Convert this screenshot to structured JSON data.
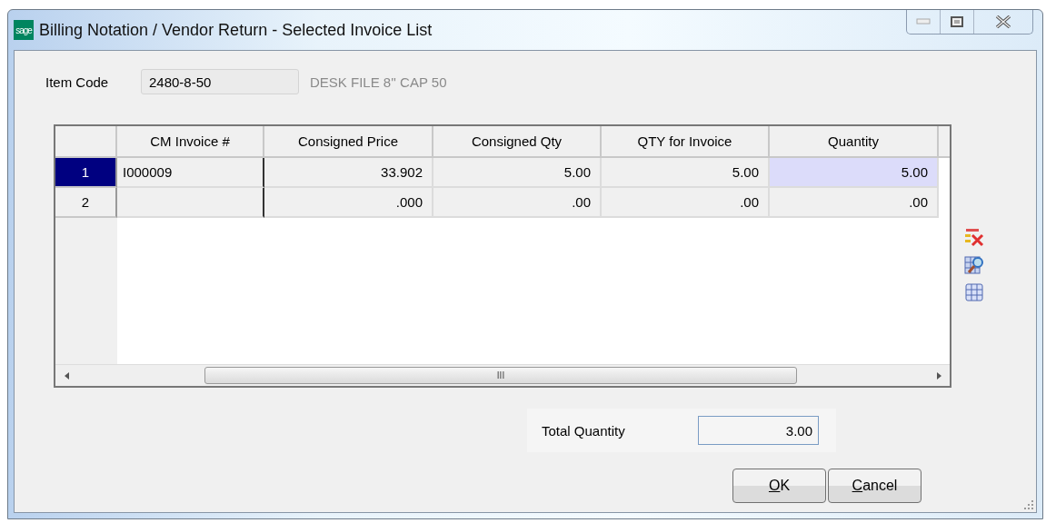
{
  "window": {
    "logo": "sage",
    "title": "Billing Notation / Vendor Return - Selected Invoice List"
  },
  "item_code": {
    "label": "Item Code",
    "value": "2480-8-50",
    "description": "DESK FILE 8'' CAP 50"
  },
  "grid": {
    "columns": [
      "CM Invoice #",
      "Consigned Price",
      "Consigned Qty",
      "QTY for Invoice",
      "Quantity"
    ],
    "rows": [
      {
        "number": "1",
        "selected": true,
        "cells": [
          {
            "text": "I000009",
            "focused": false
          },
          {
            "text": "33.902",
            "focused": false
          },
          {
            "text": "5.00",
            "focused": false
          },
          {
            "text": "5.00",
            "focused": false
          },
          {
            "text": "5.00",
            "focused": true
          }
        ]
      },
      {
        "number": "2",
        "selected": false,
        "cells": [
          {
            "text": "",
            "focused": false
          },
          {
            "text": ".000",
            "focused": false
          },
          {
            "text": ".00",
            "focused": false
          },
          {
            "text": ".00",
            "focused": false
          },
          {
            "text": ".00",
            "focused": false
          }
        ]
      }
    ],
    "scroll_thumb": "III"
  },
  "total": {
    "label": "Total Quantity",
    "value": "3.00"
  },
  "buttons": [
    "OK",
    "Cancel"
  ]
}
